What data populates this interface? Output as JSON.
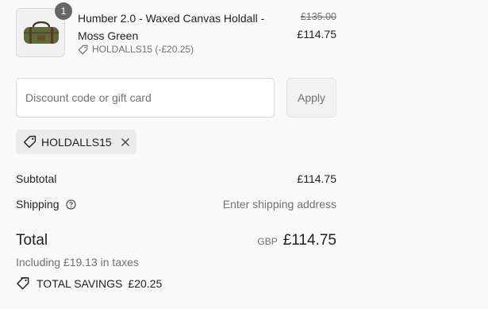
{
  "order_item": {
    "quantity": "1",
    "title": "Humber 2.0 - Waxed Canvas Holdall - Moss Green",
    "discount_note": "HOLDALLS15 (-£20.25)",
    "price_original": "£135.00",
    "price_current": "£114.75",
    "image_icon": "holdall-bag-icon"
  },
  "discount": {
    "placeholder": "Discount code or gift card",
    "apply_label": "Apply",
    "applied_code": "HOLDALLS15"
  },
  "summary": {
    "subtotal_label": "Subtotal",
    "subtotal_value": "£114.75",
    "shipping_label": "Shipping",
    "shipping_value": "Enter shipping address",
    "total_label": "Total",
    "currency": "GBP",
    "total_value": "£114.75",
    "tax_note": "Including £19.13 in taxes",
    "savings_label": "TOTAL SAVINGS",
    "savings_value": "£20.25"
  },
  "colors": {
    "text": "#1f1f1f",
    "muted": "#707070",
    "badge": "#666666",
    "chip_bg": "#ececec"
  }
}
